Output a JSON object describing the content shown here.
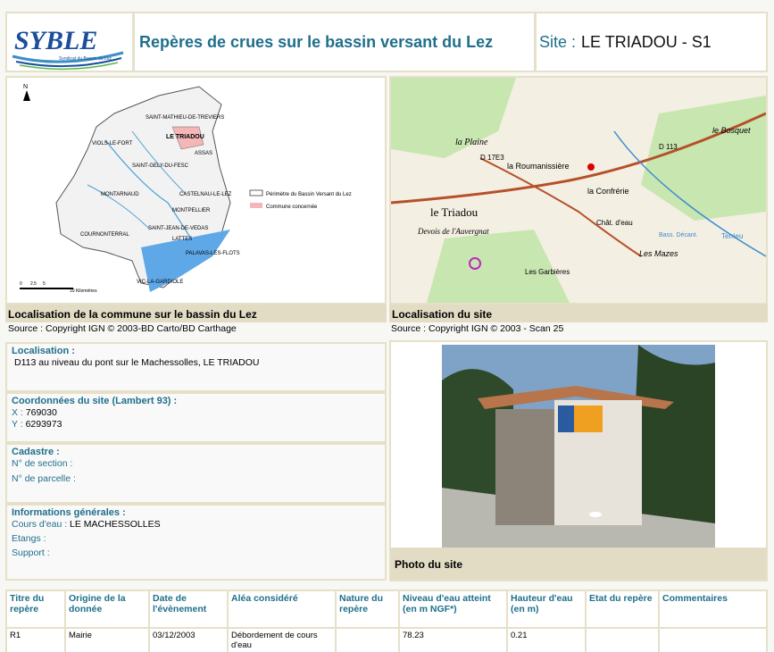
{
  "header": {
    "logo_text": "SYBLE",
    "logo_subtitle": "Syndicat du Bassin du Lez",
    "title": "Repères de crues sur le bassin versant du Lez",
    "site_label": "Site :",
    "site_value": "LE TRIADOU - S1"
  },
  "map_commune": {
    "caption": "Localisation de la commune sur le bassin du Lez",
    "source": "Source : Copyright IGN © 2003-BD Carto/BD Carthage",
    "places": [
      "SAINT-MATHIEU-DE-TREVIERS",
      "LE TRIADOU",
      "VIOLS-LE-FORT",
      "ASSAS",
      "SAINT-GELY-DU-FESC",
      "MONTARNAUD",
      "CASTELNAU-LE-LEZ",
      "MONTPELLIER",
      "COURNONTERRAL",
      "SAINT-JEAN-DE-VEDAS",
      "LATTES",
      "PALAVAS-LES-FLOTS",
      "VIC-LA-GARDIOLE"
    ],
    "legend": [
      "Périmètre du Bassin Versant du Lez",
      "Commune concernée"
    ],
    "north": "N",
    "scale": [
      "0",
      "2.5",
      "5",
      "10 Kilomètres"
    ]
  },
  "map_site": {
    "caption": "Localisation du site",
    "source": "Source : Copyright IGN © 2003 - Scan 25",
    "labels": [
      "la Plaine",
      "la Roumanissière",
      "la Confrérie",
      "le Triadou",
      "Devois de l'Auvergnat",
      "Les Mazes",
      "le Bosquet",
      "Chât. d'eau",
      "Les Garbières",
      "D 113",
      "D 17E3",
      "Terrieu",
      "Bass. Décant."
    ]
  },
  "info": {
    "localisation": {
      "label": "Localisation :",
      "value": "D113 au niveau du pont sur le Machessolles, LE TRIADOU"
    },
    "coords": {
      "label": "Coordonnées du site (Lambert 93) :",
      "x_key": "X :",
      "x_val": "769030",
      "y_key": "Y :",
      "y_val": "6293973"
    },
    "cadastre": {
      "label": "Cadastre :",
      "section_key": "N° de section :",
      "section_val": "",
      "parcelle_key": "N° de parcelle :",
      "parcelle_val": ""
    },
    "general": {
      "label": "Informations générales :",
      "cours_key": "Cours d'eau :",
      "cours_val": "LE MACHESSOLLES",
      "etangs_key": "Etangs :",
      "etangs_val": "",
      "support_key": "Support :",
      "support_val": ""
    }
  },
  "photo": {
    "caption": "Photo du site"
  },
  "table": {
    "headers": [
      "Titre du repère",
      "Origine de la donnée",
      "Date de l'évènement",
      "Aléa considéré",
      "Nature du repère",
      "Niveau d'eau atteint (en m NGF*)",
      "Hauteur d'eau (en m)",
      "Etat du repère",
      "Commentaires"
    ],
    "rows": [
      [
        "R1",
        "Mairie",
        "03/12/2003",
        "Débordement de cours d'eau",
        "",
        "78.23",
        "0.21",
        "",
        ""
      ]
    ]
  },
  "colors": {
    "accent": "#1f6f8b",
    "caption_bg": "#e2dcc4",
    "border": "#e6e0c8"
  }
}
